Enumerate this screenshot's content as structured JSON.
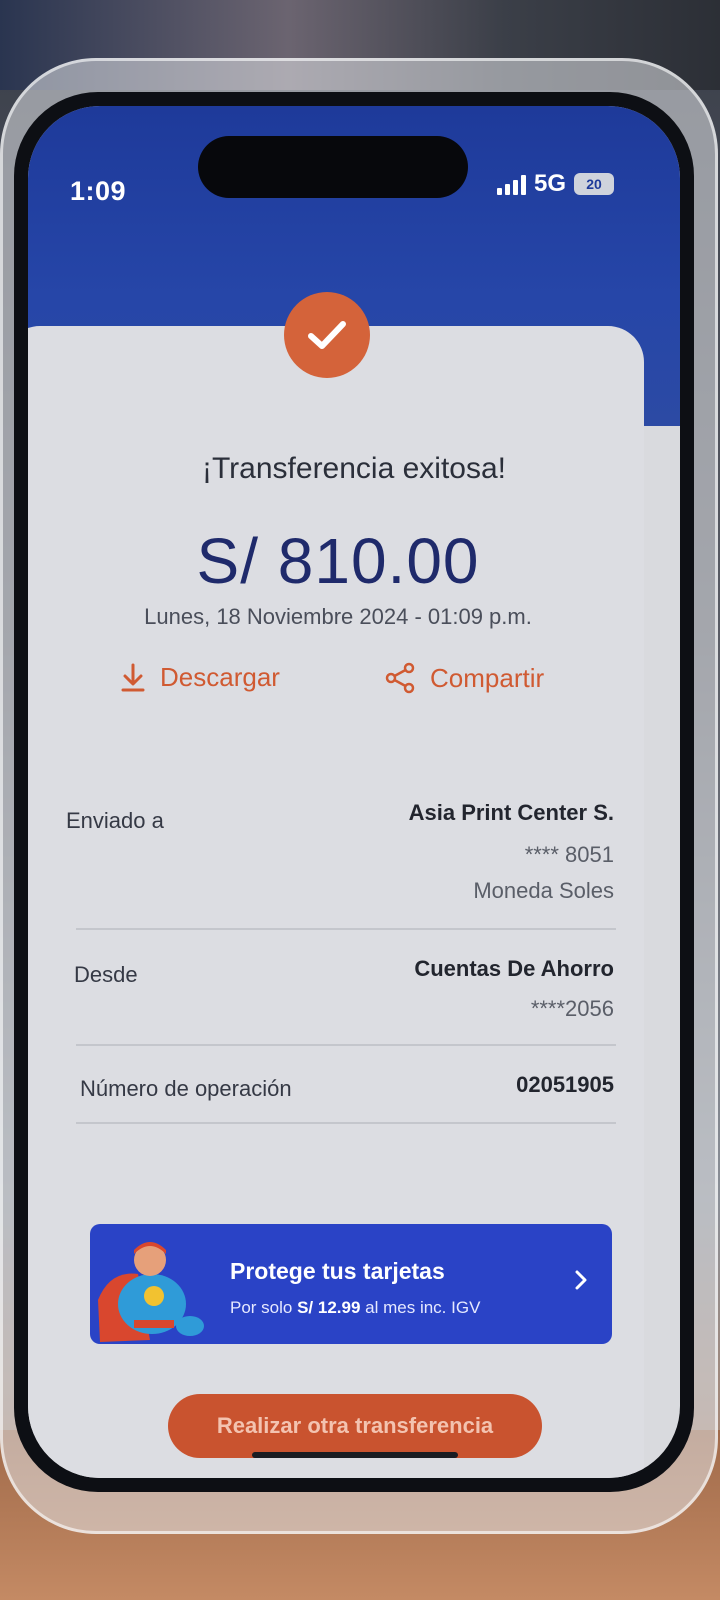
{
  "status_bar": {
    "time": "1:09",
    "network": "5G",
    "battery": "20"
  },
  "receipt": {
    "title": "¡Transferencia exitosa!",
    "amount": "S/ 810.00",
    "datetime": "Lunes, 18 Noviembre 2024 - 01:09 p.m.",
    "download_label": "Descargar",
    "share_label": "Compartir"
  },
  "details": {
    "sent_to": {
      "label": "Enviado a",
      "name": "Asia Print Center S.",
      "account": "**** 8051",
      "currency": "Moneda Soles"
    },
    "from": {
      "label": "Desde",
      "account_type": "Cuentas De Ahorro",
      "account": "****2056"
    },
    "operation": {
      "label": "Número de operación",
      "value": "02051905"
    }
  },
  "promo": {
    "title": "Protege tus tarjetas",
    "sub_prefix": "Por solo ",
    "price": "S/ 12.99",
    "sub_suffix": " al mes inc. IGV"
  },
  "cta": {
    "label": "Realizar otra transferencia"
  },
  "colors": {
    "brand_blue": "#1e3a9a",
    "accent_orange": "#d4633a",
    "promo_blue": "#2a43c6"
  }
}
